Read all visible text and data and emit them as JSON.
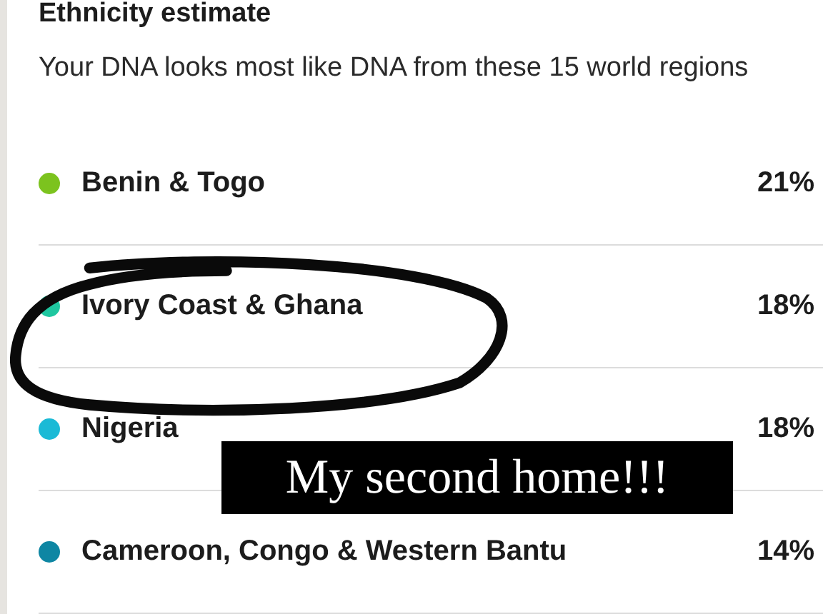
{
  "section": {
    "title": "Ethnicity estimate",
    "description": "Your DNA looks most like DNA from these 15 world regions"
  },
  "regions": [
    {
      "name": "Benin & Togo",
      "percent": "21%",
      "color": "#7cc31e"
    },
    {
      "name": "Ivory Coast & Ghana",
      "percent": "18%",
      "color": "#1fc7a0"
    },
    {
      "name": "Nigeria",
      "percent": "18%",
      "color": "#1bbad6"
    },
    {
      "name": "Cameroon, Congo & Western Bantu",
      "percent": "14%",
      "color": "#0e86a3"
    }
  ],
  "annotation": {
    "caption": "My second home!!!"
  }
}
